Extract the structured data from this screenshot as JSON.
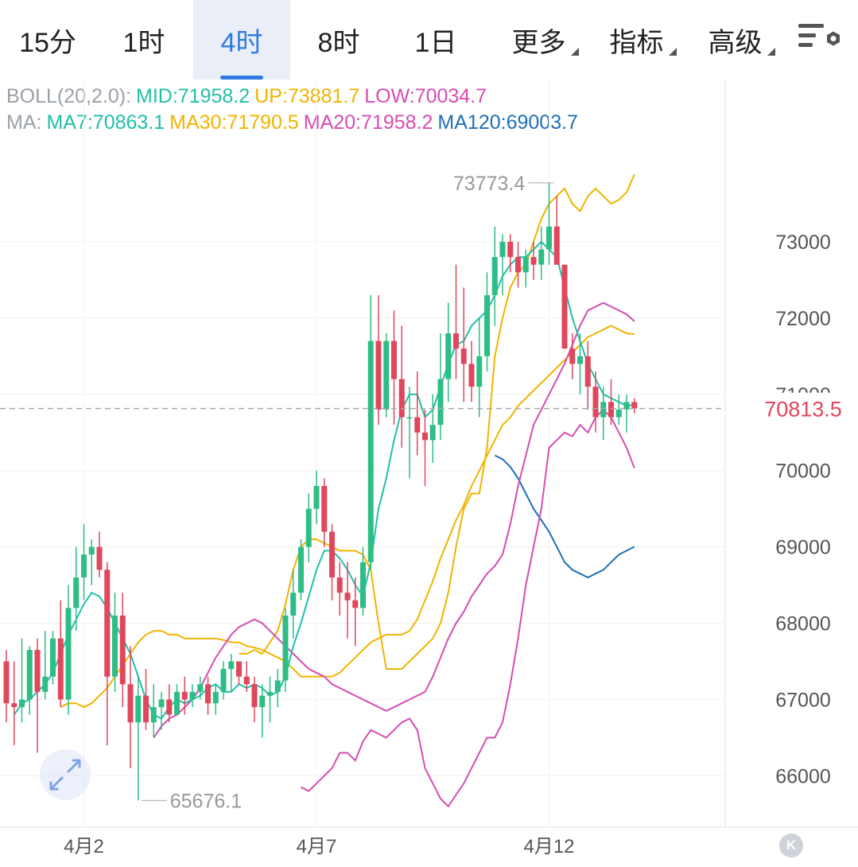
{
  "tabs": [
    {
      "label": "15分",
      "active": false,
      "dropdown": false
    },
    {
      "label": "1时",
      "active": false,
      "dropdown": false
    },
    {
      "label": "4时",
      "active": true,
      "dropdown": false
    },
    {
      "label": "8时",
      "active": false,
      "dropdown": false
    },
    {
      "label": "1日",
      "active": false,
      "dropdown": false
    },
    {
      "label": "更多",
      "active": false,
      "dropdown": true
    },
    {
      "label": "指标",
      "active": false,
      "dropdown": true
    },
    {
      "label": "高级",
      "active": false,
      "dropdown": true
    }
  ],
  "settings_icon": "chart-settings-icon",
  "boll_legend": {
    "prefix": "BOLL(20,2.0):",
    "mid": "MID:71958.2",
    "up": "UP:73881.7",
    "low": "LOW:70034.7"
  },
  "ma_legend": {
    "prefix": "MA:",
    "ma7": "MA7:70863.1",
    "ma30": "MA30:71790.5",
    "ma20": "MA20:71958.2",
    "ma120": "MA120:69003.7"
  },
  "colors": {
    "up": "#2ebd85",
    "down": "#e0475d",
    "ma7_mid": "#20c0a8",
    "ma30_up": "#f0b400",
    "ma20_low": "#d64cb3",
    "ma120": "#1f6fb8",
    "last_price": "#e0475d",
    "active_tab": "#2f7be0"
  },
  "chart_data": {
    "type": "candlestick",
    "price_axis_ticks": [
      73000,
      72000,
      71000,
      70000,
      69000,
      68000,
      67000,
      66000
    ],
    "ylim": [
      65150,
      74050
    ],
    "date_labels": [
      {
        "label": "4月2",
        "index": 10
      },
      {
        "label": "4月7",
        "index": 40
      },
      {
        "label": "4月12",
        "index": 70
      }
    ],
    "last_price": "70813.5",
    "high_marker": {
      "label": "73773.4",
      "value": 73773.4,
      "index": 71
    },
    "low_marker": {
      "label": "65676.1",
      "value": 65676.1,
      "index": 17
    },
    "candles": [
      [
        67500,
        67650,
        66700,
        66950
      ],
      [
        66950,
        67500,
        66400,
        66900
      ],
      [
        66900,
        67800,
        66700,
        67000
      ],
      [
        67000,
        67700,
        66800,
        67650
      ],
      [
        67650,
        67800,
        66300,
        67100
      ],
      [
        67100,
        67900,
        67000,
        67300
      ],
      [
        67300,
        67900,
        67200,
        67800
      ],
      [
        67800,
        68300,
        66900,
        67000
      ],
      [
        67000,
        68500,
        66800,
        68200
      ],
      [
        68200,
        69000,
        67900,
        68600
      ],
      [
        68600,
        69300,
        68300,
        68900
      ],
      [
        68900,
        69100,
        68500,
        69000
      ],
      [
        69000,
        69200,
        68600,
        68700
      ],
      [
        68700,
        68800,
        66400,
        67300
      ],
      [
        67300,
        68400,
        67100,
        68100
      ],
      [
        68100,
        68400,
        66900,
        67200
      ],
      [
        67200,
        67700,
        66100,
        66700
      ],
      [
        66700,
        67300,
        65676.1,
        67050
      ],
      [
        67050,
        67400,
        66600,
        66700
      ],
      [
        66700,
        67200,
        66500,
        66900
      ],
      [
        66900,
        67100,
        66600,
        67000
      ],
      [
        67000,
        67200,
        66700,
        66800
      ],
      [
        66800,
        67200,
        66800,
        67100
      ],
      [
        67100,
        67300,
        66800,
        67000
      ],
      [
        67000,
        67200,
        66900,
        67100
      ],
      [
        67100,
        67300,
        67000,
        67200
      ],
      [
        67200,
        67300,
        66800,
        66950
      ],
      [
        66950,
        67200,
        66800,
        67100
      ],
      [
        67100,
        67500,
        67000,
        67400
      ],
      [
        67400,
        67600,
        67100,
        67500
      ],
      [
        67500,
        67500,
        67200,
        67300
      ],
      [
        67300,
        67500,
        67100,
        67200
      ],
      [
        67200,
        67300,
        66700,
        66900
      ],
      [
        66900,
        67200,
        66500,
        67050
      ],
      [
        67050,
        67300,
        66700,
        67100
      ],
      [
        67100,
        67400,
        66900,
        67250
      ],
      [
        67250,
        68200,
        67100,
        68100
      ],
      [
        68100,
        68700,
        67800,
        68400
      ],
      [
        68400,
        69100,
        68300,
        69000
      ],
      [
        69000,
        69700,
        68800,
        69500
      ],
      [
        69500,
        70000,
        69300,
        69800
      ],
      [
        69800,
        69900,
        69000,
        69200
      ],
      [
        69200,
        69300,
        68300,
        68600
      ],
      [
        68600,
        68800,
        68100,
        68400
      ],
      [
        68400,
        68800,
        67800,
        68300
      ],
      [
        68300,
        68600,
        67700,
        68200
      ],
      [
        68200,
        69000,
        68100,
        68800
      ],
      [
        68800,
        72300,
        68700,
        71700
      ],
      [
        71700,
        72300,
        70600,
        70800
      ],
      [
        70800,
        71800,
        70700,
        71700
      ],
      [
        71700,
        72100,
        70600,
        71200
      ],
      [
        71200,
        71900,
        70300,
        70700
      ],
      [
        70700,
        71100,
        69900,
        70700
      ],
      [
        70700,
        71300,
        70200,
        70500
      ],
      [
        70500,
        70800,
        69800,
        70400
      ],
      [
        70400,
        71000,
        70100,
        70600
      ],
      [
        70600,
        71800,
        70400,
        71200
      ],
      [
        71200,
        72200,
        70900,
        71800
      ],
      [
        71800,
        72700,
        71200,
        71600
      ],
      [
        71600,
        72400,
        70900,
        71400
      ],
      [
        71400,
        71700,
        70900,
        71100
      ],
      [
        71100,
        72000,
        70700,
        71500
      ],
      [
        71500,
        72600,
        71300,
        72300
      ],
      [
        72300,
        73200,
        71900,
        72800
      ],
      [
        72800,
        73100,
        72300,
        73000
      ],
      [
        73000,
        73100,
        72600,
        72800
      ],
      [
        72800,
        73000,
        72400,
        72600
      ],
      [
        72600,
        72900,
        72400,
        72800
      ],
      [
        72800,
        73000,
        72500,
        72700
      ],
      [
        72700,
        73200,
        72500,
        72900
      ],
      [
        72900,
        73773.4,
        72700,
        73200
      ],
      [
        73200,
        73600,
        72700,
        72700
      ],
      [
        72700,
        72700,
        71600,
        71600
      ],
      [
        71600,
        71800,
        71200,
        71400
      ],
      [
        71400,
        71800,
        71000,
        71500
      ],
      [
        71500,
        71700,
        70800,
        71100
      ],
      [
        71100,
        71300,
        70500,
        70700
      ],
      [
        70700,
        71100,
        70400,
        70900
      ],
      [
        70900,
        71200,
        70600,
        70700
      ],
      [
        70700,
        71000,
        70600,
        70800
      ],
      [
        70800,
        71000,
        70500,
        70900
      ],
      [
        70900,
        70950,
        70750,
        70813.5
      ]
    ],
    "ma7": [
      66800,
      66950,
      67000,
      67100,
      67200,
      67350,
      67600,
      67850,
      68050,
      68250,
      68400,
      68350,
      68200,
      68000,
      67800,
      67600,
      67300,
      67000,
      66800,
      66750,
      66900,
      67000,
      66950,
      67000,
      67050,
      67150,
      67200,
      67100,
      67100,
      67200,
      67150,
      67200,
      67150,
      67050,
      67100,
      67300,
      67700,
      68000,
      68350,
      68700,
      68950,
      68950,
      68850,
      68700,
      68500,
      68350,
      68800,
      69500,
      69900,
      70400,
      70800,
      71000,
      71000,
      70700,
      70800,
      71100,
      71400,
      71650,
      71700,
      71900,
      72000,
      72100,
      72300,
      72550,
      72700,
      72800,
      72800,
      72900,
      73000,
      72900,
      72800,
      72400,
      72000,
      71700,
      71400,
      71200,
      71000,
      70950,
      70900,
      70850,
      70863.1
    ],
    "ma30": [
      66900,
      66950,
      66950,
      66900,
      66950,
      67050,
      67150,
      67300,
      67450,
      67600,
      67750,
      67850,
      67900,
      67900,
      67850,
      67850,
      67800,
      67800,
      67800,
      67800,
      67800,
      67780,
      67750,
      67750,
      67700,
      67680,
      67650,
      67600,
      67550,
      67500,
      67400,
      67300,
      67300,
      67300,
      67300,
      67300,
      67350,
      67450,
      67550,
      67650,
      67750,
      67800,
      67850,
      67850,
      67850,
      67900,
      68050,
      68300,
      68550,
      68850,
      69100,
      69350,
      69550,
      69800,
      70000,
      70200,
      70400,
      70600,
      70700,
      70850,
      70950,
      71050,
      71150,
      71250,
      71350,
      71450,
      71550,
      71650,
      71750,
      71800,
      71850,
      71900,
      71850,
      71800,
      71790.5
    ],
    "mid": [
      66500,
      66650,
      66750,
      66800,
      66900,
      67000,
      67150,
      67350,
      67550,
      67700,
      67850,
      67950,
      68000,
      68050,
      68000,
      67900,
      67800,
      67700,
      67600,
      67500,
      67400,
      67350,
      67300,
      67200,
      67150,
      67100,
      67050,
      67000,
      66950,
      66900,
      66850,
      66900,
      66950,
      67000,
      67050,
      67100,
      67300,
      67550,
      67800,
      68000,
      68150,
      68350,
      68500,
      68650,
      68750,
      68900,
      69300,
      69800,
      70200,
      70600,
      70800,
      71000,
      71200,
      71400,
      71650,
      71900,
      72100,
      72150,
      72200,
      72150,
      72100,
      72050,
      71958.2
    ],
    "upper": [
      67600,
      67600,
      67650,
      67600,
      67750,
      67900,
      68250,
      68700,
      69000,
      69100,
      69100,
      69050,
      69000,
      68950,
      68950,
      68950,
      68900,
      68700,
      68000,
      67400,
      67400,
      67400,
      67500,
      67600,
      67700,
      67800,
      68000,
      68400,
      69000,
      69500,
      69700,
      69700,
      70300,
      71500,
      72000,
      72400,
      72600,
      72700,
      73000,
      73300,
      73500,
      73600,
      73700,
      73500,
      73400,
      73600,
      73700,
      73600,
      73500,
      73550,
      73650,
      73881.7
    ],
    "lower": [
      65850,
      65800,
      65900,
      66000,
      66100,
      66300,
      66300,
      66200,
      66450,
      66600,
      66550,
      66500,
      66600,
      66700,
      66750,
      66600,
      66100,
      65900,
      65700,
      65600,
      65750,
      65900,
      66100,
      66300,
      66500,
      66500,
      66700,
      67200,
      67800,
      68500,
      69000,
      69500,
      70300,
      70400,
      70500,
      70450,
      70600,
      70500,
      70700,
      70800,
      70700,
      70500,
      70300,
      70034.7
    ],
    "ma120": [
      70200,
      70150,
      70050,
      69900,
      69700,
      69500,
      69350,
      69200,
      69000,
      68800,
      68700,
      68650,
      68600,
      68650,
      68700,
      68800,
      68900,
      68950,
      69003.7
    ]
  }
}
